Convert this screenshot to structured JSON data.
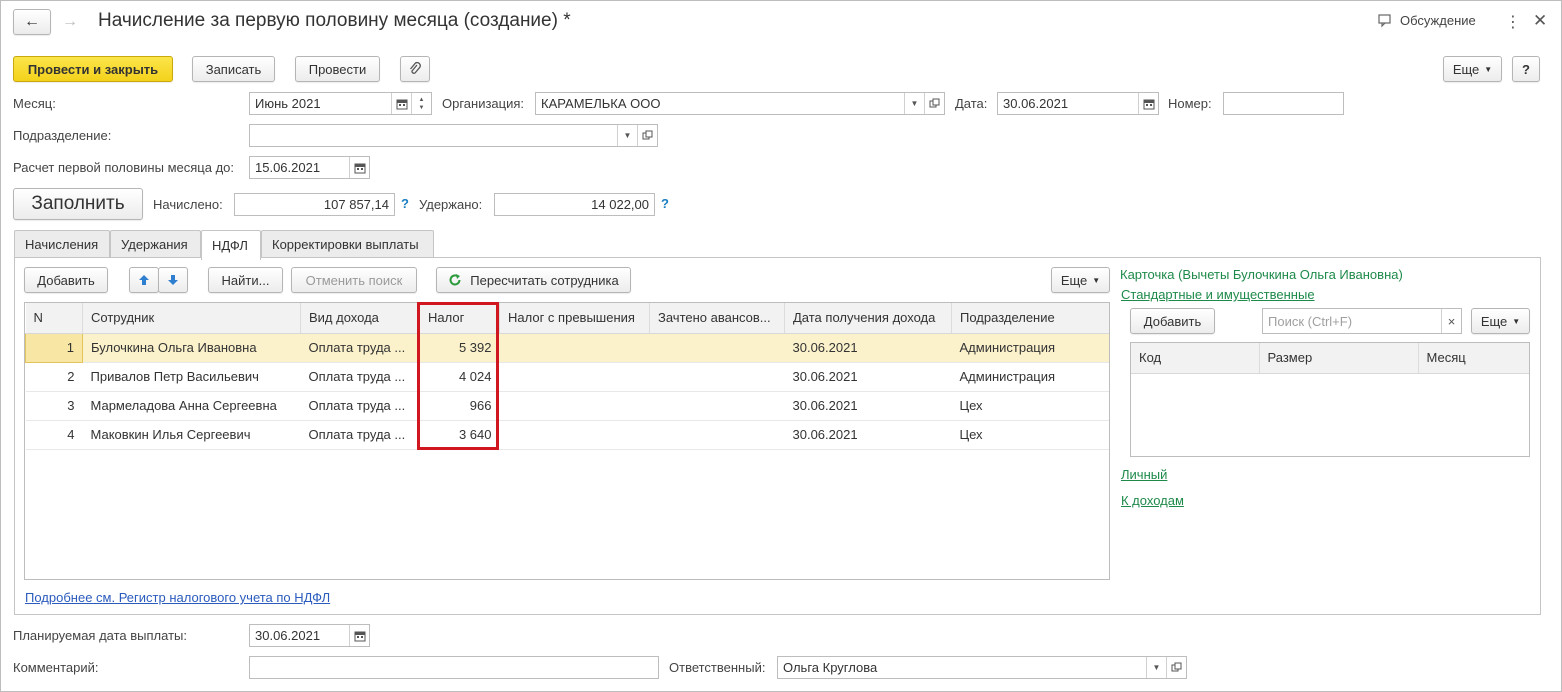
{
  "window": {
    "title": "Начисление за первую половину месяца (создание) *",
    "discussion_label": "Обсуждение"
  },
  "toolbar": {
    "post_close_label": "Провести и закрыть",
    "save_label": "Записать",
    "post_label": "Провести",
    "more_label": "Еще",
    "help_label": "?"
  },
  "form": {
    "month_label": "Месяц:",
    "month_value": "Июнь 2021",
    "org_label": "Организация:",
    "org_value": "КАРАМЕЛЬКА ООО",
    "date_label": "Дата:",
    "date_value": "30.06.2021",
    "number_label": "Номер:",
    "number_value": "",
    "subdivision_label": "Подразделение:",
    "subdivision_value": "",
    "calc_until_label": "Расчет первой половины месяца до:",
    "calc_until_value": "15.06.2021",
    "fill_label": "Заполнить",
    "accrued_label": "Начислено:",
    "accrued_value": "107 857,14",
    "withheld_label": "Удержано:",
    "withheld_value": "14 022,00",
    "q": "?"
  },
  "tabs": [
    {
      "label": "Начисления"
    },
    {
      "label": "Удержания"
    },
    {
      "label": "НДФЛ"
    },
    {
      "label": "Корректировки выплаты"
    }
  ],
  "ndfl": {
    "add_label": "Добавить",
    "find_label": "Найти...",
    "cancel_search_label": "Отменить поиск",
    "recalc_label": "Пересчитать сотрудника",
    "more_label": "Еще",
    "columns": [
      "N",
      "Сотрудник",
      "Вид дохода",
      "Налог",
      "Налог с превышения",
      "Зачтено авансов...",
      "Дата получения дохода",
      "Подразделение"
    ],
    "rows": [
      {
        "n": "1",
        "employee": "Булочкина Ольга Ивановна",
        "income": "Оплата труда ...",
        "tax": "5 392",
        "excess": "",
        "advances": "",
        "date": "30.06.2021",
        "division": "Администрация"
      },
      {
        "n": "2",
        "employee": "Привалов Петр Васильевич",
        "income": "Оплата труда ...",
        "tax": "4 024",
        "excess": "",
        "advances": "",
        "date": "30.06.2021",
        "division": "Администрация"
      },
      {
        "n": "3",
        "employee": "Мармеладова Анна Сергеевна",
        "income": "Оплата труда ...",
        "tax": "966",
        "excess": "",
        "advances": "",
        "date": "30.06.2021",
        "division": "Цех"
      },
      {
        "n": "4",
        "employee": "Маковкин Илья Сергеевич",
        "income": "Оплата труда ...",
        "tax": "3 640",
        "excess": "",
        "advances": "",
        "date": "30.06.2021",
        "division": "Цех"
      }
    ],
    "register_link": "Подробнее см. Регистр налогового учета по НДФЛ"
  },
  "side": {
    "card_title": "Карточка (Вычеты Булочкина Ольга Ивановна)",
    "std_link": "Стандартные и имущественные",
    "add_label": "Добавить",
    "search_placeholder": "Поиск (Ctrl+F)",
    "clear": "×",
    "more_label": "Еще",
    "columns": [
      "Код",
      "Размер",
      "Месяц"
    ],
    "personal_link": "Личный",
    "income_link": "К доходам"
  },
  "footer": {
    "pay_date_label": "Планируемая дата выплаты:",
    "pay_date_value": "30.06.2021",
    "comment_label": "Комментарий:",
    "comment_value": "",
    "responsible_label": "Ответственный:",
    "responsible_value": "Ольга Круглова"
  },
  "colors": {
    "primary": "#f4d21b",
    "highlight_box": "#d0161f",
    "selected_row": "#fbf2cc",
    "link_green": "#1e8a4a",
    "link_blue": "#2a5bbd"
  }
}
